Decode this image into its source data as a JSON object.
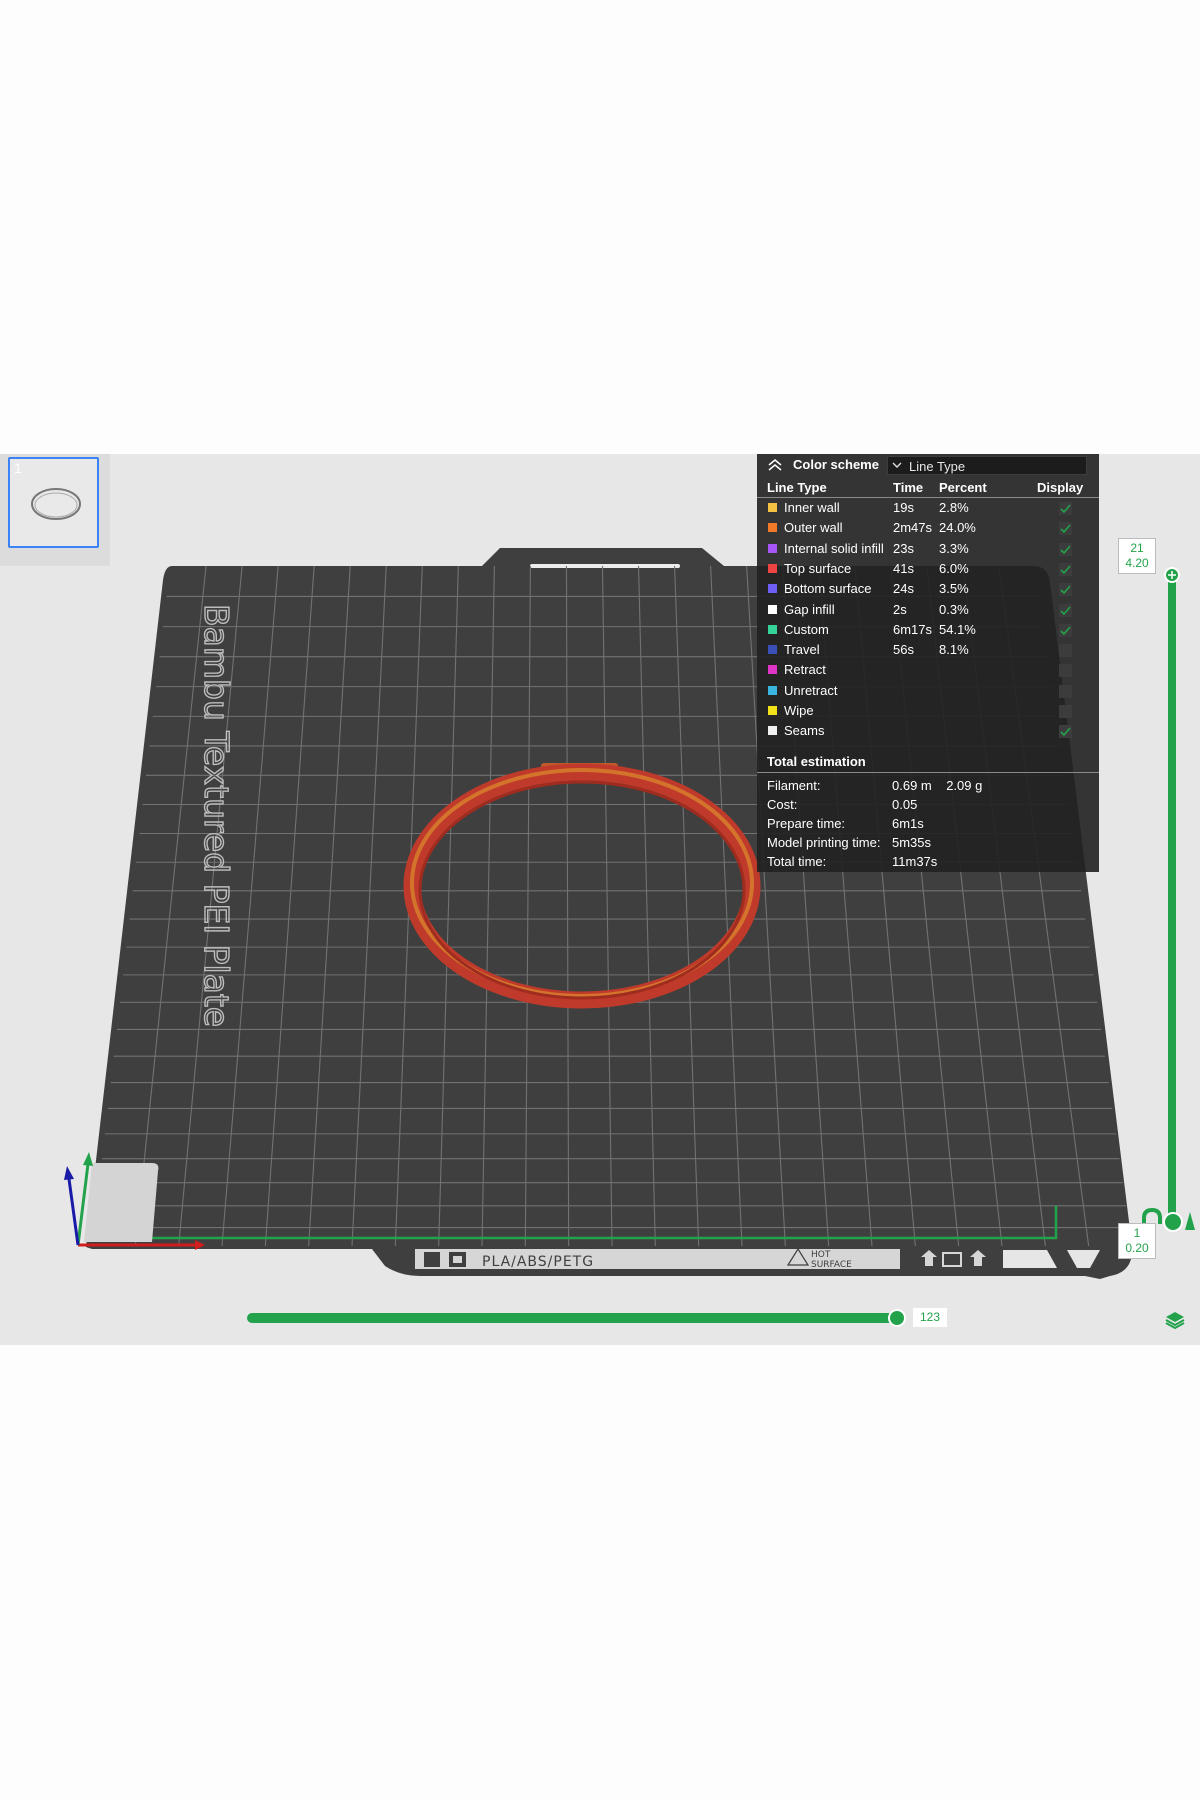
{
  "plate": {
    "thumbnail_number": "1",
    "bed_label": "Bambu Textured PEI Plate",
    "bottom_label": "PLA/ABS/PETG",
    "hot_surface_line1": "HOT",
    "hot_surface_line2": "SURFACE"
  },
  "legend": {
    "title": "Color scheme",
    "scheme_value": "Line Type",
    "headers": {
      "line_type": "Line Type",
      "time": "Time",
      "percent": "Percent",
      "display": "Display"
    },
    "rows": [
      {
        "label": "Inner wall",
        "time": "19s",
        "percent": "2.8%",
        "color": "#f5c242",
        "visible": true
      },
      {
        "label": "Outer wall",
        "time": "2m47s",
        "percent": "24.0%",
        "color": "#f07a28",
        "visible": true
      },
      {
        "label": "Internal solid infill",
        "time": "23s",
        "percent": "3.3%",
        "color": "#a855f7",
        "visible": true
      },
      {
        "label": "Top surface",
        "time": "41s",
        "percent": "6.0%",
        "color": "#ef4444",
        "visible": true
      },
      {
        "label": "Bottom surface",
        "time": "24s",
        "percent": "3.5%",
        "color": "#6d5ff5",
        "visible": true
      },
      {
        "label": "Gap infill",
        "time": "2s",
        "percent": "0.3%",
        "color": "#ffffff",
        "visible": true
      },
      {
        "label": "Custom",
        "time": "6m17s",
        "percent": "54.1%",
        "color": "#34d399",
        "visible": true
      },
      {
        "label": "Travel",
        "time": "56s",
        "percent": "8.1%",
        "color": "#3b4fb8",
        "visible": false
      },
      {
        "label": "Retract",
        "time": "",
        "percent": "",
        "color": "#e036c8",
        "visible": false
      },
      {
        "label": "Unretract",
        "time": "",
        "percent": "",
        "color": "#38b6e0",
        "visible": false
      },
      {
        "label": "Wipe",
        "time": "",
        "percent": "",
        "color": "#f2e21a",
        "visible": false
      },
      {
        "label": "Seams",
        "time": "",
        "percent": "",
        "color": "#f0f0f0",
        "visible": true
      }
    ],
    "total_title": "Total estimation",
    "estimation": [
      {
        "label": "Filament:",
        "value": "0.69 m    2.09 g"
      },
      {
        "label": "Cost:",
        "value": "0.05"
      },
      {
        "label": "Prepare time:",
        "value": "6m1s"
      },
      {
        "label": "Model printing time:",
        "value": "5m35s"
      },
      {
        "label": "Total time:",
        "value": "11m37s"
      }
    ]
  },
  "layer_slider": {
    "top_layer": "21",
    "top_height": "4.20",
    "bottom_layer": "1",
    "bottom_height": "0.20"
  },
  "move_slider": {
    "value": "123",
    "fraction": 1.0
  },
  "colors": {
    "accent": "#22a34b",
    "bed": "#3f3f3f",
    "model": "#c0392b"
  }
}
